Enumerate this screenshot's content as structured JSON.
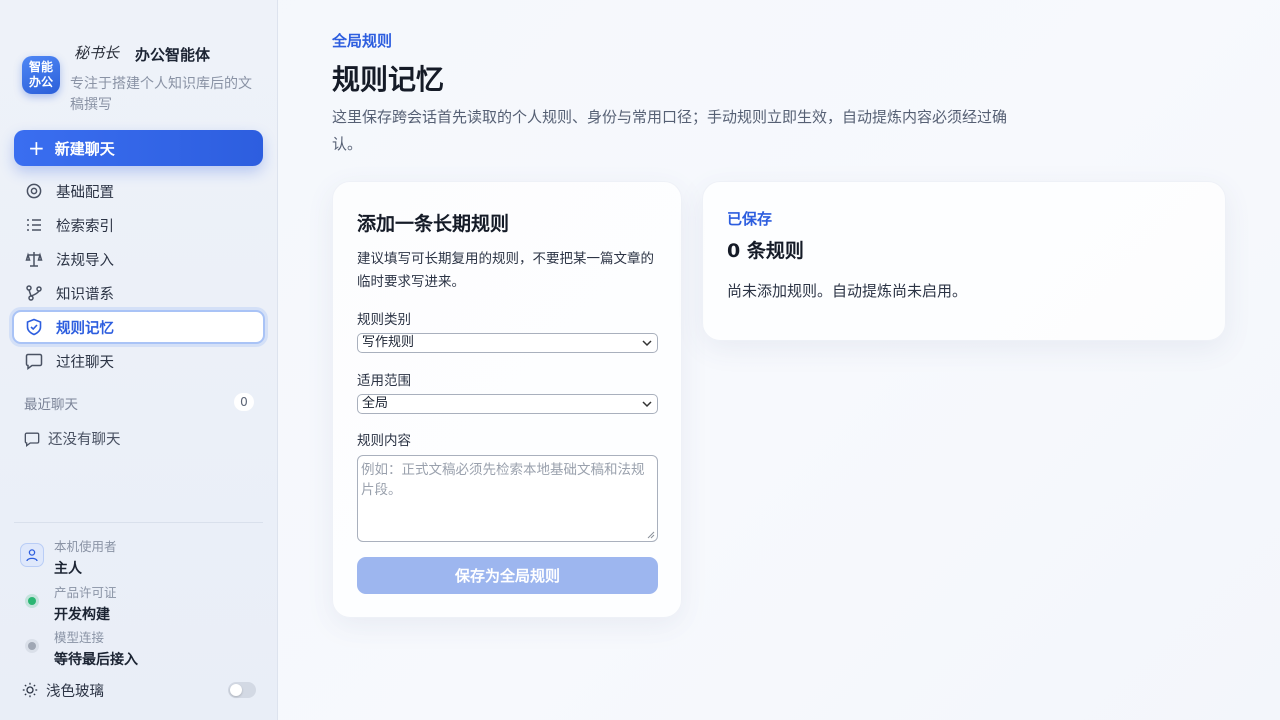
{
  "brand": {
    "logo_line1": "智能",
    "logo_line2": "办公",
    "script_name": "秘书长",
    "name": "办公智能体",
    "tagline": "专注于搭建个人知识库后的文稿撰写"
  },
  "sidebar": {
    "new_chat_label": "新建聊天",
    "items": [
      {
        "label": "基础配置",
        "icon": "gear-icon"
      },
      {
        "label": "检索索引",
        "icon": "list-icon"
      },
      {
        "label": "法规导入",
        "icon": "scale-icon"
      },
      {
        "label": "知识谱系",
        "icon": "graph-icon"
      },
      {
        "label": "规则记忆",
        "icon": "shield-icon",
        "active": true
      },
      {
        "label": "过往聊天",
        "icon": "chat-icon"
      }
    ],
    "recent_heading": "最近聊天",
    "recent_count": "0",
    "recent_empty": "还没有聊天"
  },
  "status": {
    "user_label": "本机使用者",
    "user_value": "主人",
    "license_label": "产品许可证",
    "license_value": "开发构建",
    "model_label": "模型连接",
    "model_value": "等待最后接入",
    "license_dot_color": "#2bb673",
    "model_dot_color": "#a0a7b4"
  },
  "theme": {
    "label": "浅色玻璃",
    "enabled": false
  },
  "main": {
    "eyebrow": "全局规则",
    "title": "规则记忆",
    "description": "这里保存跨会话首先读取的个人规则、身份与常用口径；手动规则立即生效，自动提炼内容必须经过确认。"
  },
  "form": {
    "title": "添加一条长期规则",
    "hint": "建议填写可长期复用的规则，不要把某一篇文章的临时要求写进来。",
    "category_label": "规则类别",
    "category_value": "写作规则",
    "scope_label": "适用范围",
    "scope_value": "全局",
    "content_label": "规则内容",
    "content_placeholder": "例如：正式文稿必须先检索本地基础文稿和法规片段。",
    "save_label": "保存为全局规则"
  },
  "saved": {
    "eyebrow": "已保存",
    "count_text": "0 条规则",
    "empty_text": "尚未添加规则。自动提炼尚未启用。"
  },
  "colors": {
    "accent": "#2d5edf",
    "button_disabled": "#9db6ef"
  }
}
